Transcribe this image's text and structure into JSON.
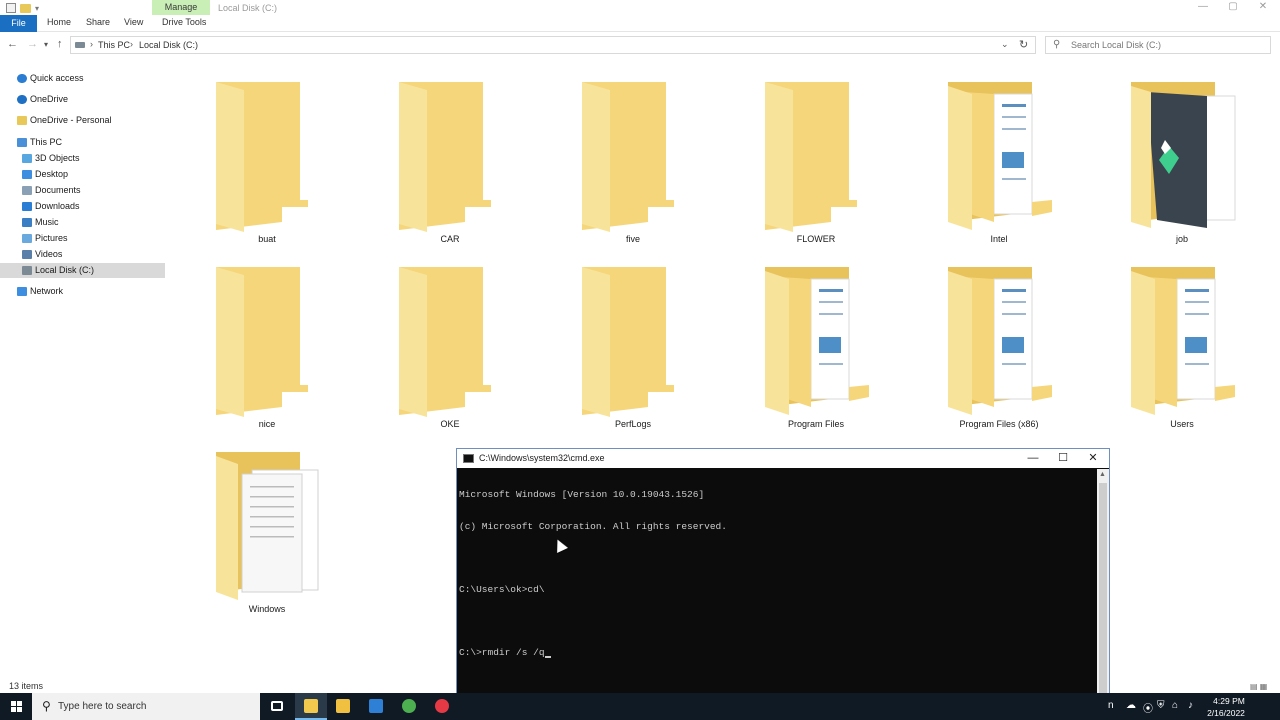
{
  "window": {
    "title": "Local Disk (C:)",
    "context_tab": "Manage",
    "controls": {
      "minimize": "—",
      "maximize": "▢",
      "close": "✕"
    }
  },
  "ribbon": {
    "tabs": [
      "File",
      "Home",
      "Share",
      "View",
      "Drive Tools"
    ]
  },
  "address": {
    "crumbs": [
      "This PC",
      "Local Disk (C:)"
    ],
    "search_placeholder": "Search Local Disk (C:)"
  },
  "nav_pane": {
    "items": [
      {
        "label": "Quick access",
        "icon": "star-icon",
        "color": "#2b7cd3"
      },
      {
        "label": "OneDrive",
        "icon": "cloud-icon",
        "color": "#1f6fc5"
      },
      {
        "label": "OneDrive - Personal",
        "icon": "folder-icon",
        "color": "#e9c85a"
      },
      {
        "label": "This PC",
        "icon": "computer-icon",
        "color": "#4a90d9"
      },
      {
        "label": "3D Objects",
        "icon": "cube-icon",
        "color": "#59a7e0"
      },
      {
        "label": "Desktop",
        "icon": "desktop-icon",
        "color": "#3d8ee0"
      },
      {
        "label": "Documents",
        "icon": "document-icon",
        "color": "#8aa0b5"
      },
      {
        "label": "Downloads",
        "icon": "download-icon",
        "color": "#2a7fd4"
      },
      {
        "label": "Music",
        "icon": "music-icon",
        "color": "#3a7fc4"
      },
      {
        "label": "Pictures",
        "icon": "pictures-icon",
        "color": "#6aa9dd"
      },
      {
        "label": "Videos",
        "icon": "video-icon",
        "color": "#5a7fa8"
      },
      {
        "label": "Local Disk (C:)",
        "icon": "drive-icon",
        "color": "#7c8a96"
      },
      {
        "label": "Network",
        "icon": "network-icon",
        "color": "#3d8ee0"
      }
    ],
    "selected_index": 11
  },
  "folders": [
    {
      "name": "buat",
      "variant": "plain"
    },
    {
      "name": "CAR",
      "variant": "plain"
    },
    {
      "name": "five",
      "variant": "plain"
    },
    {
      "name": "FLOWER",
      "variant": "plain"
    },
    {
      "name": "Intel",
      "variant": "docs"
    },
    {
      "name": "job",
      "variant": "app"
    },
    {
      "name": "nice",
      "variant": "plain"
    },
    {
      "name": "OKE",
      "variant": "plain"
    },
    {
      "name": "PerfLogs",
      "variant": "plain"
    },
    {
      "name": "Program Files",
      "variant": "docs"
    },
    {
      "name": "Program Files (x86)",
      "variant": "docs"
    },
    {
      "name": "Users",
      "variant": "docs"
    },
    {
      "name": "Windows",
      "variant": "papers"
    }
  ],
  "status": {
    "items_count": "13 items"
  },
  "cmd": {
    "title": "C:\\Windows\\system32\\cmd.exe",
    "lines": [
      "Microsoft Windows [Version 10.0.19043.1526]",
      "(c) Microsoft Corporation. All rights reserved.",
      "",
      "C:\\Users\\ok>cd\\",
      "",
      "C:\\>rmdir /s /q"
    ],
    "controls": {
      "minimize": "—",
      "maximize": "☐",
      "close": "✕"
    }
  },
  "taskbar": {
    "search_placeholder": "Type here to search",
    "apps": [
      {
        "name": "task-view",
        "color": "#ffffff"
      },
      {
        "name": "file-explorer",
        "color": "#f2c94c"
      },
      {
        "name": "microsoft-store",
        "color": "#f0c040"
      },
      {
        "name": "mail",
        "color": "#2e7fd6"
      },
      {
        "name": "chrome",
        "color": "#4caf50"
      },
      {
        "name": "vivaldi",
        "color": "#e63946"
      }
    ],
    "time": "4:29 PM",
    "date": "2/16/2022"
  },
  "colors": {
    "folder_main": "#f5d67a",
    "folder_back": "#e8c25a",
    "file_tab": "#1a6fc3",
    "manage_tab": "#c9efb6",
    "taskbar": "#101a24"
  }
}
